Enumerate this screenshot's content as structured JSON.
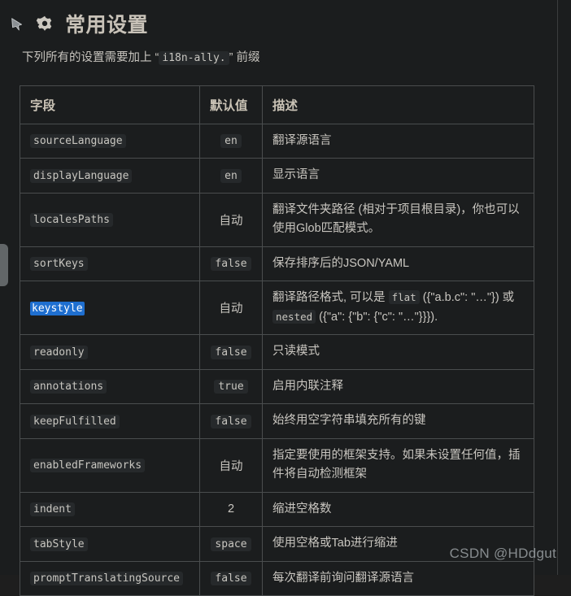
{
  "window": {
    "background": "#1b1d1e",
    "divider_color": "#3b3d3e"
  },
  "header": {
    "pin_icon": "pin-icon",
    "gear_icon": "gear-icon",
    "title": "常用设置"
  },
  "subtitle": {
    "prefix_text": "下列所有的设置需要加上 “",
    "code": "i18n-ally.",
    "suffix_text": "” 前缀"
  },
  "table": {
    "columns": [
      "字段",
      "默认值",
      "描述"
    ],
    "rows": [
      {
        "field": "sourceLanguage",
        "field_selected": false,
        "default": "en",
        "default_type": "mono",
        "desc_parts": [
          {
            "t": "text",
            "v": "翻译源语言"
          }
        ]
      },
      {
        "field": "displayLanguage",
        "field_selected": false,
        "default": "en",
        "default_type": "mono",
        "desc_parts": [
          {
            "t": "text",
            "v": "显示语言"
          }
        ]
      },
      {
        "field": "localesPaths",
        "field_selected": false,
        "default": "自动",
        "default_type": "plain",
        "desc_parts": [
          {
            "t": "text",
            "v": "翻译文件夹路径 (相对于项目根目录)，你也可以使用Glob匹配模式。"
          }
        ]
      },
      {
        "field": "sortKeys",
        "field_selected": false,
        "default": "false",
        "default_type": "mono",
        "desc_parts": [
          {
            "t": "text",
            "v": "保存排序后的JSON/YAML"
          }
        ]
      },
      {
        "field": "keystyle",
        "field_selected": true,
        "default": "自动",
        "default_type": "plain",
        "desc_parts": [
          {
            "t": "text",
            "v": "翻译路径格式, 可以是 "
          },
          {
            "t": "code",
            "v": "flat"
          },
          {
            "t": "text",
            "v": " ({\"a.b.c\": \"…\"}) 或 "
          },
          {
            "t": "code",
            "v": "nested"
          },
          {
            "t": "text",
            "v": " ({\"a\": {\"b\": {\"c\": \"…\"}}})."
          }
        ]
      },
      {
        "field": "readonly",
        "field_selected": false,
        "default": "false",
        "default_type": "mono",
        "desc_parts": [
          {
            "t": "text",
            "v": "只读模式"
          }
        ]
      },
      {
        "field": "annotations",
        "field_selected": false,
        "default": "true",
        "default_type": "mono",
        "desc_parts": [
          {
            "t": "text",
            "v": "启用内联注释"
          }
        ]
      },
      {
        "field": "keepFulfilled",
        "field_selected": false,
        "default": "false",
        "default_type": "mono",
        "desc_parts": [
          {
            "t": "text",
            "v": "始终用空字符串填充所有的键"
          }
        ]
      },
      {
        "field": "enabledFrameworks",
        "field_selected": false,
        "default": "自动",
        "default_type": "plain",
        "desc_parts": [
          {
            "t": "text",
            "v": "指定要使用的框架支持。如果未设置任何值，插件将自动检测框架"
          }
        ]
      },
      {
        "field": "indent",
        "field_selected": false,
        "default": "2",
        "default_type": "plain",
        "desc_parts": [
          {
            "t": "text",
            "v": "缩进空格数"
          }
        ]
      },
      {
        "field": "tabStyle",
        "field_selected": false,
        "default": "space",
        "default_type": "mono",
        "desc_parts": [
          {
            "t": "text",
            "v": "使用空格或Tab进行缩进"
          }
        ]
      },
      {
        "field": "promptTranslatingSource",
        "field_selected": false,
        "default": "false",
        "default_type": "mono",
        "desc_parts": [
          {
            "t": "text",
            "v": "每次翻译前询问翻译源语言"
          }
        ]
      }
    ]
  },
  "selection": {
    "color": "#1f6fd0",
    "text_color": "#ffffff"
  },
  "watermark": {
    "text": "CSDN @HDdgut"
  },
  "scrollbar": {
    "thumb_color": "#6e7376"
  }
}
